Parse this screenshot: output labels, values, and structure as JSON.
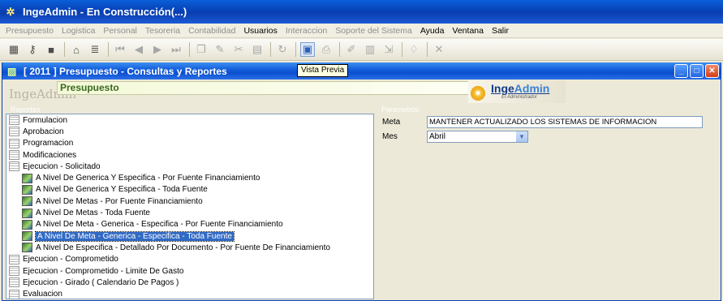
{
  "app": {
    "title": "IngeAdmin -   En Construcción(...)"
  },
  "menu": [
    {
      "label": "Presupuesto",
      "enabled": false
    },
    {
      "label": "Logistica",
      "enabled": false
    },
    {
      "label": "Personal",
      "enabled": false
    },
    {
      "label": "Tesoreria",
      "enabled": false
    },
    {
      "label": "Contabilidad",
      "enabled": false
    },
    {
      "label": "Usuarios",
      "enabled": true
    },
    {
      "label": "Interaccion",
      "enabled": false
    },
    {
      "label": "Soporte del Sistema",
      "enabled": false
    },
    {
      "label": "Ayuda",
      "enabled": true
    },
    {
      "label": "Ventana",
      "enabled": true
    },
    {
      "label": "Salir",
      "enabled": true
    }
  ],
  "toolbar": {
    "tooltip": "Vista Previa",
    "buttons": [
      "calculator-icon",
      "key-icon",
      "bank-icon",
      "stack-icon",
      "first-icon",
      "prev-icon",
      "next-icon",
      "last-icon",
      "new-icon",
      "edit-icon",
      "cut-icon",
      "save-icon",
      "refresh-icon",
      "preview-icon",
      "print-icon",
      "tools-icon",
      "grid-icon",
      "export-icon",
      "link-icon",
      "close-icon"
    ]
  },
  "window": {
    "title": "[ 2011 ] Presupuesto - Consultas y Reportes",
    "brand": "IngeAdmin",
    "section": "Presupuesto",
    "logo_main_a": "Inge",
    "logo_main_b": "Admin",
    "logo_sub": "El Administrador"
  },
  "left_pane": {
    "legend": "Reportes",
    "items": [
      {
        "label": "Formulacion",
        "level": 0
      },
      {
        "label": "Aprobacion",
        "level": 0
      },
      {
        "label": "Programacion",
        "level": 0
      },
      {
        "label": "Modificaciones",
        "level": 0
      },
      {
        "label": "Ejecucion - Solicitado",
        "level": 0
      },
      {
        "label": "A Nivel De Generica Y Especifica - Por Fuente Financiamiento",
        "level": 1
      },
      {
        "label": "A Nivel De Generica Y Especifica - Toda Fuente",
        "level": 1
      },
      {
        "label": "A Nivel De Metas - Por Fuente Financiamiento",
        "level": 1
      },
      {
        "label": "A Nivel De Metas - Toda Fuente",
        "level": 1
      },
      {
        "label": "A Nivel De Meta - Generica - Especifica - Por Fuente Financiamiento",
        "level": 1
      },
      {
        "label": "A Nivel De Meta - Generica - Especifica - Toda Fuente",
        "level": 1,
        "selected": true
      },
      {
        "label": "A Nivel De Especifica - Detallado Por Documento - Por Fuente De Financiamiento",
        "level": 1
      },
      {
        "label": "Ejecucion - Comprometido",
        "level": 0
      },
      {
        "label": "Ejecucion - Comprometido - Limite De Gasto",
        "level": 0
      },
      {
        "label": "Ejecucion - Girado ( Calendario De Pagos )",
        "level": 0
      },
      {
        "label": "Evaluacion",
        "level": 0
      }
    ]
  },
  "right_pane": {
    "legend": "Parametros",
    "meta_label": "Meta",
    "meta_value": "MANTENER ACTUALIZADO LOS SISTEMAS DE INFORMACION",
    "mes_label": "Mes",
    "mes_value": "Abril"
  }
}
